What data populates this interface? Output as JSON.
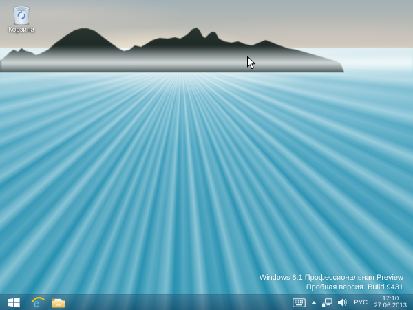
{
  "desktop": {
    "icons": [
      {
        "id": "recycle-bin",
        "label": "Корзина"
      }
    ],
    "watermark": {
      "line1": "Windows 8.1 Профессиональная Preview",
      "line2": "Пробная версия. Build 9431"
    }
  },
  "taskbar": {
    "pinned": [
      {
        "id": "internet-explorer",
        "icon": "internet-explorer-icon"
      },
      {
        "id": "file-explorer",
        "icon": "folder-icon"
      }
    ],
    "tray": {
      "icons": [
        "touch-keyboard-icon",
        "chevron-up-icon",
        "network-icon",
        "volume-icon"
      ],
      "language": "РУС",
      "time": "17:10",
      "date": "27.06.2013"
    }
  },
  "colors": {
    "sea_deep": "#1f8cac",
    "sea_mid": "#2b92b2",
    "taskbar_tint": "rgba(10,45,75,0.52)",
    "rock": "#131f1c",
    "watermark_text": "#ffffff"
  }
}
